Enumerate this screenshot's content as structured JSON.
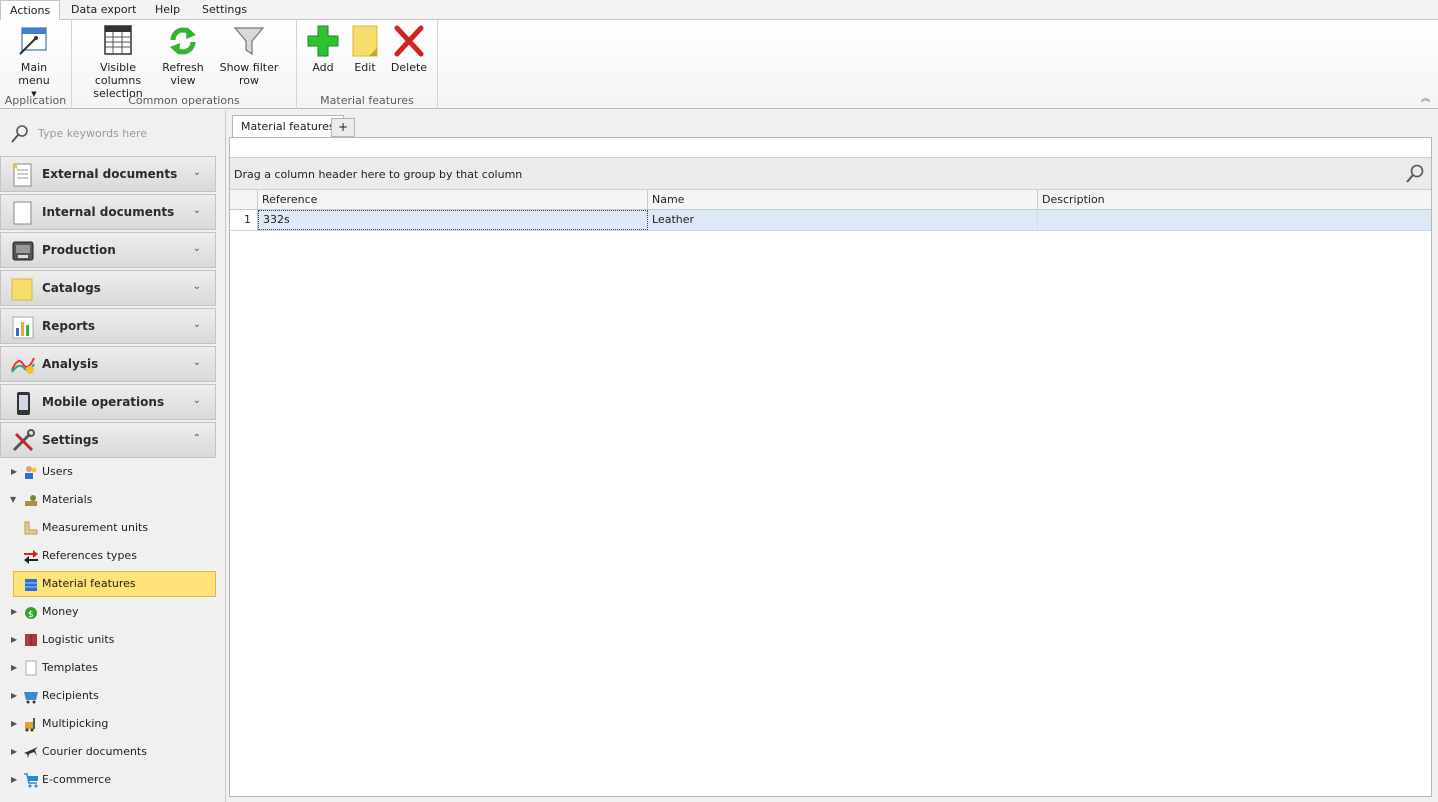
{
  "menu": {
    "tabs": [
      {
        "label": "Actions"
      },
      {
        "label": "Data export"
      },
      {
        "label": "Help"
      },
      {
        "label": "Settings"
      }
    ]
  },
  "ribbon": {
    "groups": [
      {
        "caption": "Application",
        "buttons": [
          {
            "label": "Main menu",
            "icon": "main-menu-icon"
          }
        ]
      },
      {
        "caption": "Common operations",
        "buttons": [
          {
            "label": "Visible columns selection",
            "line1": "Visible columns",
            "line2": "selection",
            "icon": "columns-icon"
          },
          {
            "label": "Refresh view",
            "line1": "Refresh",
            "line2": "view",
            "icon": "refresh-icon"
          },
          {
            "label": "Show filter row",
            "icon": "filter-icon"
          }
        ]
      },
      {
        "caption": "Material features",
        "buttons": [
          {
            "label": "Add",
            "icon": "add-icon"
          },
          {
            "label": "Edit",
            "icon": "edit-icon"
          },
          {
            "label": "Delete",
            "icon": "delete-icon"
          }
        ]
      }
    ]
  },
  "sidebar": {
    "search_placeholder": "Type keywords here",
    "sections": [
      {
        "label": "External documents",
        "icon": "external-documents-icon",
        "expanded": false
      },
      {
        "label": "Internal documents",
        "icon": "internal-documents-icon",
        "expanded": false
      },
      {
        "label": "Production",
        "icon": "production-icon",
        "expanded": false
      },
      {
        "label": "Catalogs",
        "icon": "catalogs-icon",
        "expanded": false
      },
      {
        "label": "Reports",
        "icon": "reports-icon",
        "expanded": false
      },
      {
        "label": "Analysis",
        "icon": "analysis-icon",
        "expanded": false
      },
      {
        "label": "Mobile operations",
        "icon": "mobile-icon",
        "expanded": false
      },
      {
        "label": "Settings",
        "icon": "settings-tools-icon",
        "expanded": true
      }
    ],
    "tree": [
      {
        "label": "Users",
        "icon": "users-icon",
        "level": 0,
        "arrow": "collapsed"
      },
      {
        "label": "Materials",
        "icon": "materials-icon",
        "level": 0,
        "arrow": "expanded"
      },
      {
        "label": "Measurement units",
        "icon": "ruler-icon",
        "level": 1
      },
      {
        "label": "References types",
        "icon": "references-icon",
        "level": 1
      },
      {
        "label": "Material features",
        "icon": "material-features-icon",
        "level": 1,
        "selected": true
      },
      {
        "label": "Money",
        "icon": "money-icon",
        "level": 0,
        "arrow": "collapsed"
      },
      {
        "label": "Logistic units",
        "icon": "logistic-units-icon",
        "level": 0,
        "arrow": "collapsed"
      },
      {
        "label": "Templates",
        "icon": "templates-icon",
        "level": 0,
        "arrow": "collapsed"
      },
      {
        "label": "Recipients",
        "icon": "recipients-icon",
        "level": 0,
        "arrow": "collapsed"
      },
      {
        "label": "Multipicking",
        "icon": "multipicking-icon",
        "level": 0,
        "arrow": "collapsed"
      },
      {
        "label": "Courier documents",
        "icon": "plane-icon",
        "level": 0,
        "arrow": "collapsed"
      },
      {
        "label": "E-commerce",
        "icon": "cart-icon",
        "level": 0,
        "arrow": "collapsed"
      }
    ]
  },
  "main": {
    "tab_label": "Material features",
    "add_tab_label": "+",
    "group_panel_text": "Drag a column header here to group by that column",
    "columns": [
      "Reference",
      "Name",
      "Description"
    ],
    "rows": [
      {
        "num": "1",
        "reference": "332s",
        "name": "Leather",
        "description": ""
      }
    ]
  },
  "colors": {
    "selection": "#ffe27a",
    "row_highlight": "#dde9f7"
  }
}
